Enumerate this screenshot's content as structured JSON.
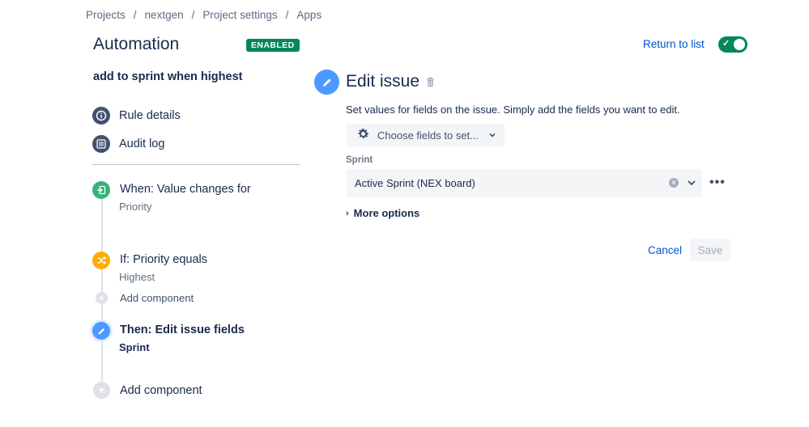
{
  "breadcrumb": [
    "Projects",
    "nextgen",
    "Project settings",
    "Apps"
  ],
  "breadcrumb_separator": "/",
  "header": {
    "title": "Automation",
    "status_badge": "ENABLED",
    "return_link": "Return to list",
    "enabled_toggle": true
  },
  "sidebar": {
    "rule_name": "add to sprint when highest",
    "items": [
      {
        "label": "Rule details",
        "icon": "info-icon"
      },
      {
        "label": "Audit log",
        "icon": "list-icon"
      }
    ],
    "steps": {
      "trigger": {
        "title": "When: Value changes for",
        "subtitle": "Priority",
        "icon": "trigger-icon",
        "color": "#36b37e"
      },
      "condition": {
        "title": "If: Priority equals",
        "subtitle": "Highest",
        "icon": "shuffle-icon",
        "color": "#ffab00"
      },
      "add_component_1": "Add component",
      "action": {
        "title": "Then: Edit issue fields",
        "subtitle": "Sprint",
        "icon": "pencil-icon",
        "color": "#4c9aff"
      },
      "add_component_2": "Add component"
    }
  },
  "editor": {
    "title": "Edit issue",
    "description": "Set values for fields on the issue. Simply add the fields you want to edit.",
    "choose_fields": "Choose fields to set...",
    "field_label": "Sprint",
    "sprint_value": "Active Sprint (NEX board)",
    "more_options": "More options",
    "cancel": "Cancel",
    "save": "Save"
  },
  "colors": {
    "accent": "#0052cc",
    "enabled_green": "#00875a",
    "text": "#172b4d"
  }
}
